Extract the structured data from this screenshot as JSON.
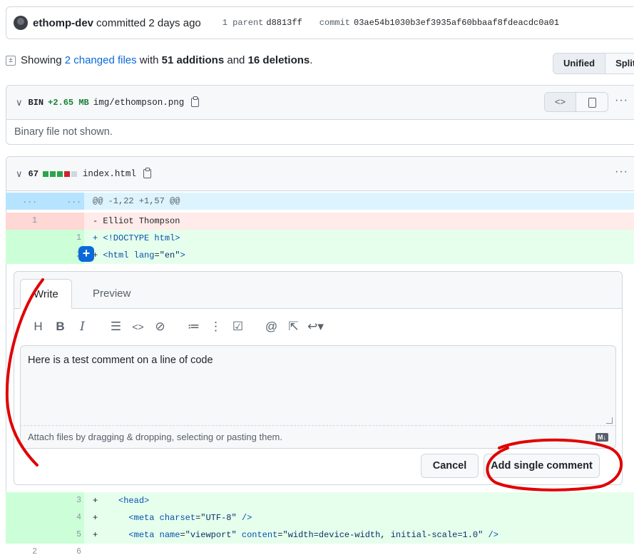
{
  "commit": {
    "author": "ethomp-dev",
    "action": "committed 2 days ago",
    "parent_label": "1 parent",
    "parent_sha": "d8813ff",
    "commit_label": "commit",
    "commit_sha": "03ae54b1030b3ef3935af60bbaaf8fdeacdc0a01"
  },
  "summary": {
    "prefix": "Showing",
    "changed_files": "2 changed files",
    "with": "with",
    "additions": "51 additions",
    "and": "and",
    "deletions": "16 deletions",
    "period": "."
  },
  "view_toggle": {
    "unified": "Unified",
    "split": "Split"
  },
  "file1": {
    "chevron": "∨",
    "badge": "BIN",
    "size": "+2.65 MB",
    "name": "img/ethompson.png",
    "message": "Binary file not shown.",
    "kebab": "···",
    "code_icon": "<>"
  },
  "file2": {
    "chevron": "∨",
    "count": "67",
    "name": "index.html",
    "kebab": "···",
    "stat_colors": [
      "#2da44e",
      "#2da44e",
      "#2da44e",
      "#cf222e",
      "#d0d7de"
    ]
  },
  "diff": {
    "hunk_old": "...",
    "hunk_new": "...",
    "hunk_text": "@@ -1,22 +1,57 @@",
    "del1": {
      "old": "1",
      "text": "- Elliot Thompson"
    },
    "add1": {
      "new": "1",
      "text": "+ <!DOCTYPE html>"
    },
    "add2": {
      "new": "2",
      "prefix": "+ ",
      "tag_open": "<html ",
      "attr": "lang",
      "eq": "=",
      "val": "\"en\"",
      "tag_close": ">"
    },
    "add3": {
      "new": "3",
      "prefix": "+",
      "text": "<head>"
    },
    "add4": {
      "new": "4",
      "prefix": "+",
      "tag_open": "<meta ",
      "attr": "charset",
      "eq": "=",
      "val": "\"UTF-8\"",
      "tag_close": " />"
    },
    "add5": {
      "new": "5",
      "prefix": "+",
      "tag_open": "<meta ",
      "attr1": "name",
      "eq1": "=",
      "val1": "\"viewport\"",
      "attr2": " content",
      "eq2": "=",
      "val2": "\"width=device-width, initial-scale=1.0\"",
      "tag_close": " />"
    },
    "ctx6": {
      "old": "2",
      "new": "6"
    }
  },
  "comment": {
    "tab_write": "Write",
    "tab_preview": "Preview",
    "body": "Here is a test comment on a line of code",
    "attach_hint": "Attach files by dragging & dropping, selecting or pasting them.",
    "md_badge": "M↓",
    "cancel": "Cancel",
    "submit": "Add single comment",
    "toolbar": [
      "heading-icon",
      "bold-icon",
      "italic-icon",
      "quote-icon",
      "code-icon",
      "link-icon",
      "unordered-list-icon",
      "ordered-list-icon",
      "task-list-icon",
      "mention-icon",
      "reference-icon",
      "reply-icon"
    ]
  },
  "plus_button": "+",
  "annotation_color": "#e00000"
}
